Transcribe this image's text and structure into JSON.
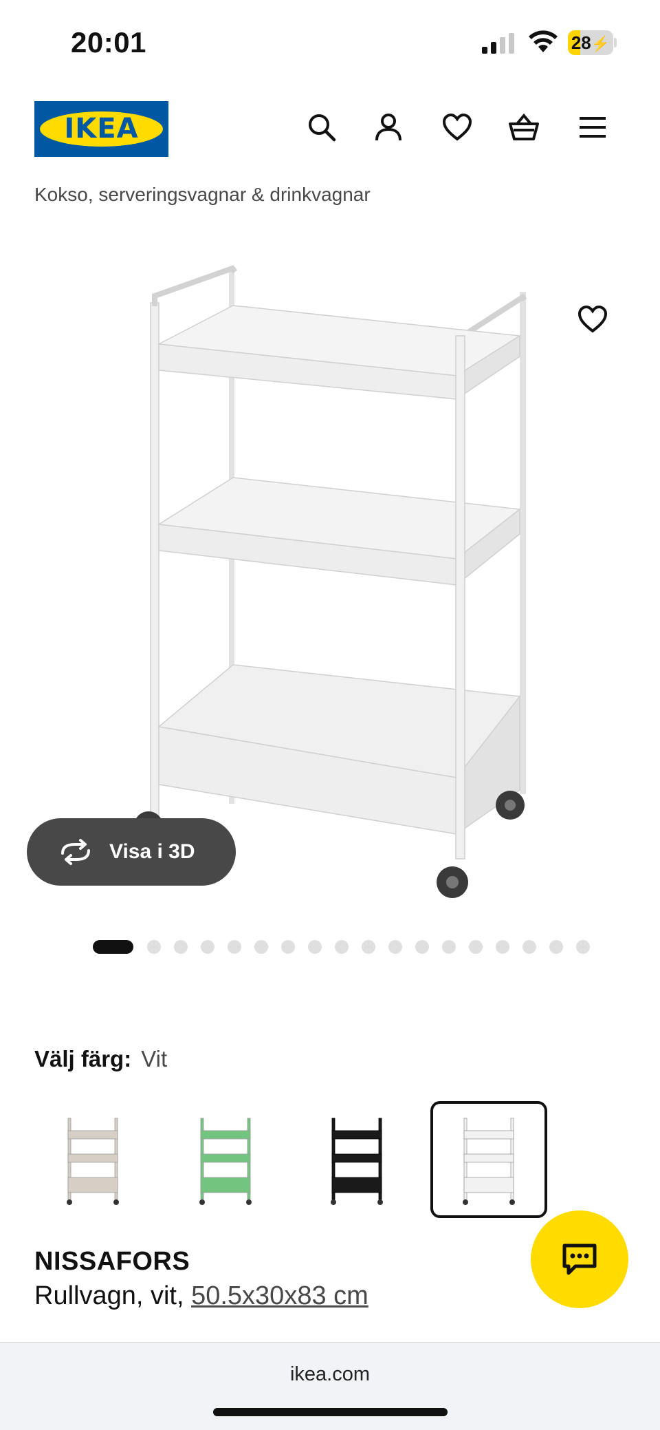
{
  "status": {
    "time": "20:01",
    "battery": "28",
    "battery_level": 0.28
  },
  "header": {
    "logo_text": "IKEA"
  },
  "breadcrumb": "Kokso, serveringsvagnar & drinkvagnar",
  "gallery": {
    "view3d_label": "Visa i 3D",
    "total_images": 18,
    "active_index": 0
  },
  "color": {
    "label": "Välj färg:",
    "selected": "Vit",
    "options": [
      {
        "name": "beige",
        "color": "#d6cfc6"
      },
      {
        "name": "green",
        "color": "#72c47f"
      },
      {
        "name": "black",
        "color": "#1a1a1a"
      },
      {
        "name": "white",
        "color": "#f2f2f2"
      }
    ]
  },
  "product": {
    "name": "NISSAFORS",
    "desc_prefix": "Rullvagn, vit, ",
    "dimensions": "50.5x30x83 cm"
  },
  "browser": {
    "url": "ikea.com"
  },
  "colors": {
    "ikea_blue": "#0058a3",
    "ikea_yellow": "#ffdb00"
  }
}
